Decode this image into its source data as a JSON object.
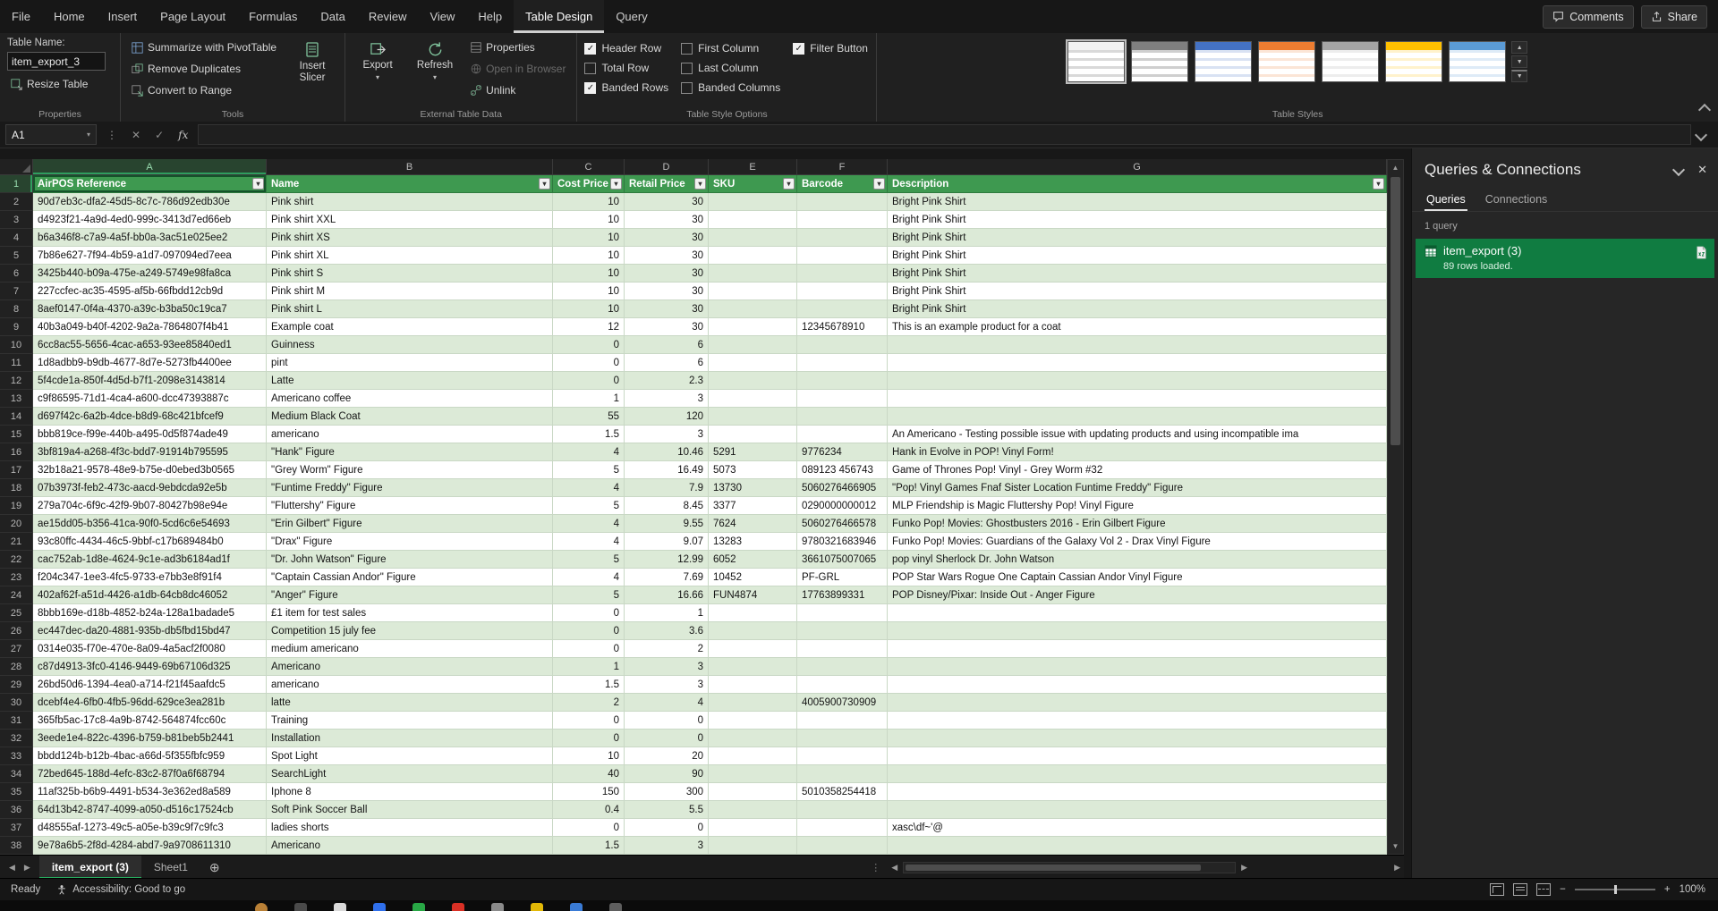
{
  "window": {
    "comments_label": "Comments",
    "share_label": "Share"
  },
  "menu": {
    "tabs": [
      "File",
      "Home",
      "Insert",
      "Page Layout",
      "Formulas",
      "Data",
      "Review",
      "View",
      "Help",
      "Table Design",
      "Query"
    ],
    "active_tab": "Table Design"
  },
  "ribbon": {
    "properties_group": {
      "table_name_label": "Table Name:",
      "table_name_value": "item_export_3",
      "resize_table_label": "Resize Table",
      "group_label": "Properties"
    },
    "tools_group": {
      "buttons": [
        "Summarize with PivotTable",
        "Remove Duplicates",
        "Convert to Range"
      ],
      "insert_slicer_label": "Insert Slicer",
      "group_label": "Tools"
    },
    "external_group": {
      "export_label": "Export",
      "refresh_label": "Refresh",
      "buttons": [
        "Properties",
        "Open in Browser",
        "Unlink"
      ],
      "disabled_button": "Open in Browser",
      "group_label": "External Table Data"
    },
    "style_options_group": {
      "options": [
        {
          "label": "Header Row",
          "checked": true
        },
        {
          "label": "Total Row",
          "checked": false
        },
        {
          "label": "Banded Rows",
          "checked": true
        },
        {
          "label": "First Column",
          "checked": false
        },
        {
          "label": "Last Column",
          "checked": false
        },
        {
          "label": "Banded Columns",
          "checked": false
        },
        {
          "label": "Filter Button",
          "checked": true
        }
      ],
      "group_label": "Table Style Options"
    },
    "table_styles_group": {
      "group_label": "Table Styles",
      "swatches": [
        {
          "name": "light-plain",
          "header": "#f2f2f2",
          "stripe": "#d9d9d9",
          "selected": true
        },
        {
          "name": "light-dark-gray",
          "header": "#7f7f7f",
          "stripe": "#cfcfcf",
          "selected": false
        },
        {
          "name": "medium-blue",
          "header": "#4472c4",
          "stripe": "#d9e2f3",
          "selected": false
        },
        {
          "name": "medium-orange",
          "header": "#ed7d31",
          "stripe": "#fbe5d6",
          "selected": false
        },
        {
          "name": "medium-gray",
          "header": "#a5a5a5",
          "stripe": "#ededed",
          "selected": false
        },
        {
          "name": "medium-gold",
          "header": "#ffc000",
          "stripe": "#fff2cc",
          "selected": false
        },
        {
          "name": "medium-light-blue",
          "header": "#5b9bd5",
          "stripe": "#deebf7",
          "selected": false
        }
      ]
    }
  },
  "formula_bar": {
    "name_box": "A1",
    "fx_label": "fx",
    "formula_value": ""
  },
  "sheet": {
    "column_letters": [
      "A",
      "B",
      "C",
      "D",
      "E",
      "F",
      "G"
    ],
    "table_headers": [
      "AirPOS Reference",
      "Name",
      "Cost Price",
      "Retail Price",
      "SKU",
      "Barcode",
      "Description"
    ],
    "rows": [
      [
        "90d7eb3c-dfa2-45d5-8c7c-786d92edb30e",
        "Pink shirt",
        "10",
        "30",
        "",
        "",
        "Bright Pink Shirt"
      ],
      [
        "d4923f21-4a9d-4ed0-999c-3413d7ed66eb",
        "Pink shirt XXL",
        "10",
        "30",
        "",
        "",
        "Bright Pink Shirt"
      ],
      [
        "b6a346f8-c7a9-4a5f-bb0a-3ac51e025ee2",
        "Pink shirt XS",
        "10",
        "30",
        "",
        "",
        "Bright Pink Shirt"
      ],
      [
        "7b86e627-7f94-4b59-a1d7-097094ed7eea",
        "Pink shirt XL",
        "10",
        "30",
        "",
        "",
        "Bright Pink Shirt"
      ],
      [
        "3425b440-b09a-475e-a249-5749e98fa8ca",
        "Pink shirt S",
        "10",
        "30",
        "",
        "",
        "Bright Pink Shirt"
      ],
      [
        "227ccfec-ac35-4595-af5b-66fbdd12cb9d",
        "Pink shirt M",
        "10",
        "30",
        "",
        "",
        "Bright Pink Shirt"
      ],
      [
        "8aef0147-0f4a-4370-a39c-b3ba50c19ca7",
        "Pink shirt L",
        "10",
        "30",
        "",
        "",
        "Bright Pink Shirt"
      ],
      [
        "40b3a049-b40f-4202-9a2a-7864807f4b41",
        "Example coat",
        "12",
        "30",
        "",
        "12345678910",
        "This is an example product for a coat"
      ],
      [
        "6cc8ac55-5656-4cac-a653-93ee85840ed1",
        "Guinness",
        "0",
        "6",
        "",
        "",
        ""
      ],
      [
        "1d8adbb9-b9db-4677-8d7e-5273fb4400ee",
        "pint",
        "0",
        "6",
        "",
        "",
        ""
      ],
      [
        "5f4cde1a-850f-4d5d-b7f1-2098e3143814",
        "Latte",
        "0",
        "2.3",
        "",
        "",
        ""
      ],
      [
        "c9f86595-71d1-4ca4-a600-dcc47393887c",
        "Americano coffee",
        "1",
        "3",
        "",
        "",
        ""
      ],
      [
        "d697f42c-6a2b-4dce-b8d9-68c421bfcef9",
        "Medium Black Coat",
        "55",
        "120",
        "",
        "",
        ""
      ],
      [
        "bbb819ce-f99e-440b-a495-0d5f874ade49",
        "americano",
        "1.5",
        "3",
        "",
        "",
        "An Americano - Testing possible issue with updating products and using incompatible ima"
      ],
      [
        "3bf819a4-a268-4f3c-bdd7-91914b795595",
        "\"Hank\" Figure",
        "4",
        "10.46",
        "5291",
        "9776234",
        "Hank in Evolve in POP! Vinyl Form!"
      ],
      [
        "32b18a21-9578-48e9-b75e-d0ebed3b0565",
        "\"Grey Worm\" Figure",
        "5",
        "16.49",
        "5073",
        "089123 456743",
        "Game of Thrones Pop! Vinyl - Grey Worm #32"
      ],
      [
        "07b3973f-feb2-473c-aacd-9ebdcda92e5b",
        "\"Funtime Freddy\" Figure",
        "4",
        "7.9",
        "13730",
        "5060276466905",
        "\"Pop! Vinyl Games Fnaf Sister Location Funtime Freddy\" Figure"
      ],
      [
        "279a704c-6f9c-42f9-9b07-80427b98e94e",
        "\"Fluttershy\" Figure",
        "5",
        "8.45",
        "3377",
        "0290000000012",
        "MLP Friendship is Magic Fluttershy Pop! Vinyl Figure"
      ],
      [
        "ae15dd05-b356-41ca-90f0-5cd6c6e54693",
        "\"Erin Gilbert\" Figure",
        "4",
        "9.55",
        "7624",
        "5060276466578",
        "Funko Pop! Movies: Ghostbusters 2016 - Erin Gilbert Figure"
      ],
      [
        "93c80ffc-4434-46c5-9bbf-c17b689484b0",
        "\"Drax\" Figure",
        "4",
        "9.07",
        "13283",
        "9780321683946",
        "Funko Pop! Movies: Guardians of the Galaxy Vol 2 - Drax Vinyl Figure"
      ],
      [
        "cac752ab-1d8e-4624-9c1e-ad3b6184ad1f",
        "\"Dr. John Watson\" Figure",
        "5",
        "12.99",
        "6052",
        "3661075007065",
        "pop vinyl Sherlock Dr. John Watson"
      ],
      [
        "f204c347-1ee3-4fc5-9733-e7bb3e8f91f4",
        "\"Captain Cassian Andor\" Figure",
        "4",
        "7.69",
        "10452",
        "PF-GRL",
        "POP Star Wars Rogue One Captain Cassian Andor Vinyl Figure"
      ],
      [
        "402af62f-a51d-4426-a1db-64cb8dc46052",
        "\"Anger\" Figure",
        "5",
        "16.66",
        "FUN4874",
        "17763899331",
        "POP Disney/Pixar: Inside Out - Anger Figure"
      ],
      [
        "8bbb169e-d18b-4852-b24a-128a1badade5",
        "£1 item for test sales",
        "0",
        "1",
        "",
        "",
        ""
      ],
      [
        "ec447dec-da20-4881-935b-db5fbd15bd47",
        "Competition 15 july fee",
        "0",
        "3.6",
        "",
        "",
        ""
      ],
      [
        "0314e035-f70e-470e-8a09-4a5acf2f0080",
        "medium americano",
        "0",
        "2",
        "",
        "",
        ""
      ],
      [
        "c87d4913-3fc0-4146-9449-69b67106d325",
        "Americano",
        "1",
        "3",
        "",
        "",
        ""
      ],
      [
        "26bd50d6-1394-4ea0-a714-f21f45aafdc5",
        "americano",
        "1.5",
        "3",
        "",
        "",
        ""
      ],
      [
        "dcebf4e4-6fb0-4fb5-96dd-629ce3ea281b",
        "latte",
        "2",
        "4",
        "",
        "4005900730909",
        ""
      ],
      [
        "365fb5ac-17c8-4a9b-8742-564874fcc60c",
        "Training",
        "0",
        "0",
        "",
        "",
        ""
      ],
      [
        "3eede1e4-822c-4396-b759-b81beb5b2441",
        "Installation",
        "0",
        "0",
        "",
        "",
        ""
      ],
      [
        "bbdd124b-b12b-4bac-a66d-5f355fbfc959",
        "Spot Light",
        "10",
        "20",
        "",
        "",
        ""
      ],
      [
        "72bed645-188d-4efc-83c2-87f0a6f68794",
        "SearchLight",
        "40",
        "90",
        "",
        "",
        ""
      ],
      [
        "11af325b-b6b9-4491-b534-3e362ed8a589",
        "Iphone 8",
        "150",
        "300",
        "",
        "5010358254418",
        ""
      ],
      [
        "64d13b42-8747-4099-a050-d516c17524cb",
        "Soft Pink Soccer Ball",
        "0.4",
        "5.5",
        "",
        "",
        ""
      ],
      [
        "d48555af-1273-49c5-a05e-b39c9f7c9fc3",
        "ladies shorts",
        "0",
        "0",
        "",
        "",
        "xasc\\df~'@"
      ],
      [
        "9e78a6b5-2f8d-4284-abd7-9a9708611310",
        "Americano",
        "1.5",
        "3",
        "",
        "",
        ""
      ]
    ]
  },
  "sheet_tabs": {
    "tabs": [
      {
        "label": "item_export (3)",
        "active": true
      },
      {
        "label": "Sheet1",
        "active": false
      }
    ]
  },
  "status_bar": {
    "ready_label": "Ready",
    "accessibility_label": "Accessibility: Good to go",
    "zoom_value": "100%"
  },
  "queries_panel": {
    "title": "Queries & Connections",
    "tabs": [
      "Queries",
      "Connections"
    ],
    "active_tab": "Queries",
    "count_label": "1 query",
    "query": {
      "name": "item_export (3)",
      "status": "89 rows loaded."
    }
  },
  "taskbar": {
    "icon_colors": [
      "#b98036",
      "#4a4a4a",
      "#d9d9d9",
      "#2f6feb",
      "#28a745",
      "#d93025",
      "#8a8a8a",
      "#e2b807",
      "#3a7bd5",
      "#5e5e5e"
    ]
  },
  "colors": {
    "accent_green": "#107C41",
    "table_header_green": "#3e9950",
    "band_green": "#dcead7"
  }
}
